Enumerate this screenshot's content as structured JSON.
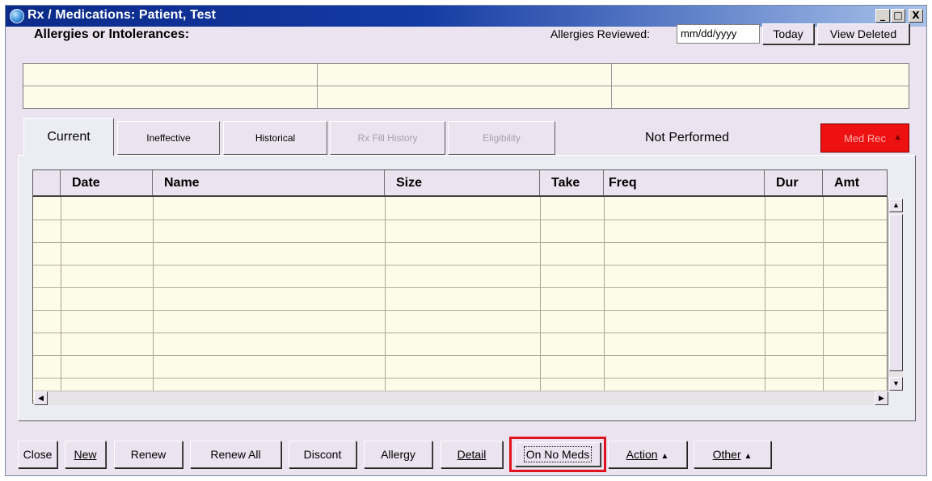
{
  "window": {
    "title": "Rx / Medications: Patient, Test",
    "min": "_",
    "max": "□",
    "close": "X"
  },
  "allergies": {
    "label": "Allergies or Intolerances:",
    "reviewed_label": "Allergies Reviewed:",
    "reviewed_date": "mm/dd/yyyy",
    "today_label": "Today",
    "view_deleted_label": "View Deleted"
  },
  "tabs": [
    {
      "label": "Current",
      "state": "active"
    },
    {
      "label": "Ineffective",
      "state": "enabled"
    },
    {
      "label": "Historical",
      "state": "enabled"
    },
    {
      "label": "Rx Fill History",
      "state": "disabled"
    },
    {
      "label": "Eligibility",
      "state": "disabled"
    }
  ],
  "status_text": "Not Performed",
  "med_rec": {
    "label": "Med Rec",
    "color": "#ee1111"
  },
  "table": {
    "columns": [
      "",
      "Date",
      "Name",
      "Size",
      "Take",
      "Freq",
      "Dur",
      "Amt"
    ],
    "rows": []
  },
  "buttons": {
    "close": "Close",
    "new": "New",
    "renew": "Renew",
    "renew_all": "Renew All",
    "discont": "Discont",
    "allergy": "Allergy",
    "detail": "Detail",
    "on_no_meds": "On No Meds",
    "action": "Action",
    "other": "Other"
  },
  "highlight_color": "#e0141e"
}
